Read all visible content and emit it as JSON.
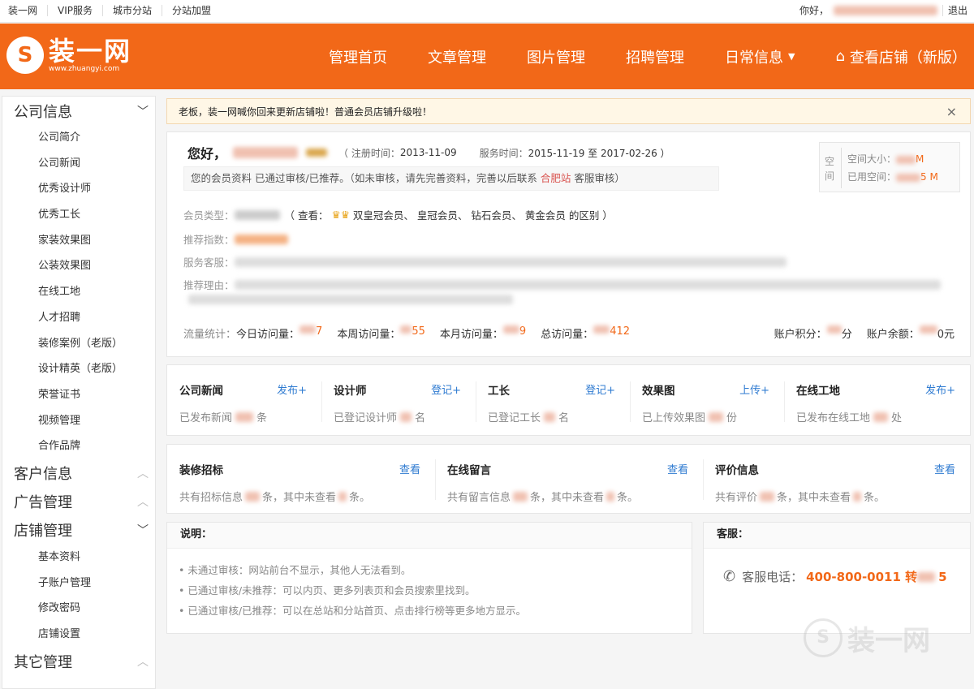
{
  "topbar": {
    "links": [
      "装一网",
      "VIP服务",
      "城市分站",
      "分站加盟"
    ],
    "greeting": "你好，",
    "logout": "退出"
  },
  "header": {
    "logo_mark": "S",
    "logo_text": "装一网",
    "logo_url_text": "www.zhuangyi.com",
    "nav": [
      "管理首页",
      "文章管理",
      "图片管理",
      "招聘管理",
      "日常信息",
      "查看店铺（新版）"
    ]
  },
  "sidebar": {
    "groups": [
      {
        "label": "公司信息",
        "expanded": true,
        "items": [
          "公司简介",
          "公司新闻",
          "优秀设计师",
          "优秀工长",
          "家装效果图",
          "公装效果图",
          "在线工地",
          "人才招聘",
          "装修案例（老版）",
          "设计精英（老版）",
          "荣誉证书",
          "视频管理",
          "合作品牌"
        ]
      },
      {
        "label": "客户信息",
        "expanded": false,
        "items": []
      },
      {
        "label": "广告管理",
        "expanded": false,
        "items": []
      },
      {
        "label": "店铺管理",
        "expanded": true,
        "items": [
          "基本资料",
          "子账户管理",
          "修改密码",
          "店铺设置"
        ]
      },
      {
        "label": "其它管理",
        "expanded": false,
        "items": []
      }
    ]
  },
  "notice": {
    "text": "老板，装一网喊你回来更新店铺啦！普通会员店铺升级啦！",
    "close": "×"
  },
  "profile": {
    "hello": "您好，",
    "register_label": "（ 注册时间：",
    "register_date": "2013-11-09",
    "service_label": "服务时间：",
    "service_range": "2015-11-19 至 2017-02-26 ）",
    "tips_prefix": "您的会员资料 已通过审核/已推荐。（如未审核，请先完善资料，完善以后联系 ",
    "tips_city": "合肥站",
    "tips_suffix": " 客服审核）",
    "space_vertical": "空间",
    "space_size_label": "空间大小：",
    "space_size_unit": "M",
    "space_used_label": "已用空间：",
    "space_used_unit": "5 M",
    "member_type_label": "会员类型：",
    "member_type_desc": "（ 查看：",
    "member_levels": "双皇冠会员、 皇冠会员、 钻石会员、 黄金会员 的区别 ）",
    "recommend_index_label": "推荐指数：",
    "service_staff_label": "服务客服：",
    "recommend_reason_label": "推荐理由：",
    "stats_label": "流量统计：",
    "today_label": "今日访问量：",
    "today_tail": "7",
    "week_label": "本周访问量：",
    "week_tail": "55",
    "month_label": "本月访问量：",
    "month_tail": "9",
    "total_label": "总访问量：",
    "total_tail": "412",
    "points_label": "账户积分：",
    "points_unit": "分",
    "balance_label": "账户余额：",
    "balance_unit": "0元"
  },
  "quick": [
    {
      "title": "公司新闻",
      "action": "发布+",
      "desc_pre": "已发布新闻",
      "desc_post": "条"
    },
    {
      "title": "设计师",
      "action": "登记+",
      "desc_pre": "已登记设计师",
      "desc_post": "名"
    },
    {
      "title": "工长",
      "action": "登记+",
      "desc_pre": "已登记工长",
      "desc_post": "名"
    },
    {
      "title": "效果图",
      "action": "上传+",
      "desc_pre": "已上传效果图",
      "desc_post": "份"
    },
    {
      "title": "在线工地",
      "action": "发布+",
      "desc_pre": "已发布在线工地",
      "desc_post": "处"
    }
  ],
  "info": [
    {
      "title": "装修招标",
      "action": "查看",
      "desc_pre": "共有招标信息",
      "desc_mid": "条，其中未查看",
      "desc_post": "条。"
    },
    {
      "title": "在线留言",
      "action": "查看",
      "desc_pre": "共有留言信息",
      "desc_mid": "条，其中未查看",
      "desc_post": "条。"
    },
    {
      "title": "评价信息",
      "action": "查看",
      "desc_pre": "共有评价",
      "desc_mid": "条，其中未查看",
      "desc_post": "条。"
    }
  ],
  "explain": {
    "title": "说明：",
    "lines": [
      "• 未通过审核：网站前台不显示，其他人无法看到。",
      "• 已通过审核/未推荐：可以内页、更多列表页和会员搜索里找到。",
      "• 已通过审核/已推荐：可以在总站和分站首页、点击排行榜等更多地方显示。"
    ]
  },
  "service": {
    "title": "客服：",
    "phone_label": "客服电话：",
    "phone": "400-800-0011 转 ",
    "phone_tail": "5"
  },
  "watermark": {
    "mark": "S",
    "text": "装一网"
  },
  "colors": {
    "brand": "#f26818",
    "link": "#2f7bd1",
    "highlight": "#d9534f"
  }
}
